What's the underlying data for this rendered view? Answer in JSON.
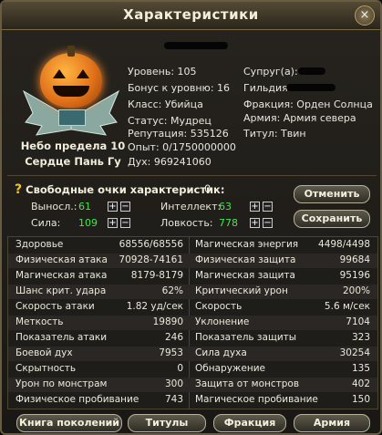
{
  "window": {
    "title": "Характеристики",
    "close_label": "×"
  },
  "character": {
    "name_line1": "Небо предела 10",
    "name_line2": "Сердце Пань Гу",
    "level_label": "Уровень: 105",
    "level_bonus_label": "Бонус к уровню: 16",
    "class_label": "Класс: Убийца",
    "status_label": "Статус: Мудрец",
    "reputation_label": "Репутация: 535126",
    "experience_label": "Опыт: 0/1750000000",
    "spirit_label": "Дух: 969241060",
    "spouse_label": "Супруг(а):",
    "guild_label": "Гильдия:",
    "faction_label": "Фракция: Орден Солнца",
    "army_label": "Армия: Армия севера",
    "titul_label": "Титул: Твин"
  },
  "points": {
    "free_label": "Свободные очки характеристик:",
    "free_value": "0",
    "stamina_label": "Выносл.:",
    "stamina_value": "61",
    "strength_label": "Сила:",
    "strength_value": "109",
    "intellect_label": "Интеллект:",
    "intellect_value": "63",
    "dexterity_label": "Ловкость:",
    "dexterity_value": "778",
    "plus_label": "+",
    "minus_label": "−",
    "cancel_label": "Отменить",
    "save_label": "Сохранить"
  },
  "stats": [
    {
      "left_label": "Здоровье",
      "left_value": "68556/68556",
      "right_label": "Магическая энергия",
      "right_value": "4498/4498"
    },
    {
      "left_label": "Физическая атака",
      "left_value": "70928-74161",
      "right_label": "Физическая защита",
      "right_value": "99684"
    },
    {
      "left_label": "Магическая атака",
      "left_value": "8179-8179",
      "right_label": "Магическая защита",
      "right_value": "95196"
    },
    {
      "left_label": "Шанс крит. удара",
      "left_value": "62%",
      "right_label": "Критический урон",
      "right_value": "200%"
    },
    {
      "left_label": "Скорость атаки",
      "left_value": "1.82 уд/сек",
      "right_label": "Скорость",
      "right_value": "5.6 м/сек"
    },
    {
      "left_label": "Меткость",
      "left_value": "19890",
      "right_label": "Уклонение",
      "right_value": "7104"
    },
    {
      "left_label": "Показатель атаки",
      "left_value": "246",
      "right_label": "Показатель защиты",
      "right_value": "323"
    },
    {
      "left_label": "Боевой дух",
      "left_value": "7953",
      "right_label": "Сила духа",
      "right_value": "30254"
    },
    {
      "left_label": "Скрытность",
      "left_value": "0",
      "right_label": "Обнаружение",
      "right_value": "135"
    },
    {
      "left_label": "Урон по монстрам",
      "left_value": "300",
      "right_label": "Защита от монстров",
      "right_value": "402"
    },
    {
      "left_label": "Физическое пробивание",
      "left_value": "743",
      "right_label": "Магическое пробивание",
      "right_value": "150"
    }
  ],
  "bottom_buttons": {
    "generations": "Книга поколений",
    "titles": "Титулы",
    "faction": "Фракция",
    "army": "Армия"
  }
}
